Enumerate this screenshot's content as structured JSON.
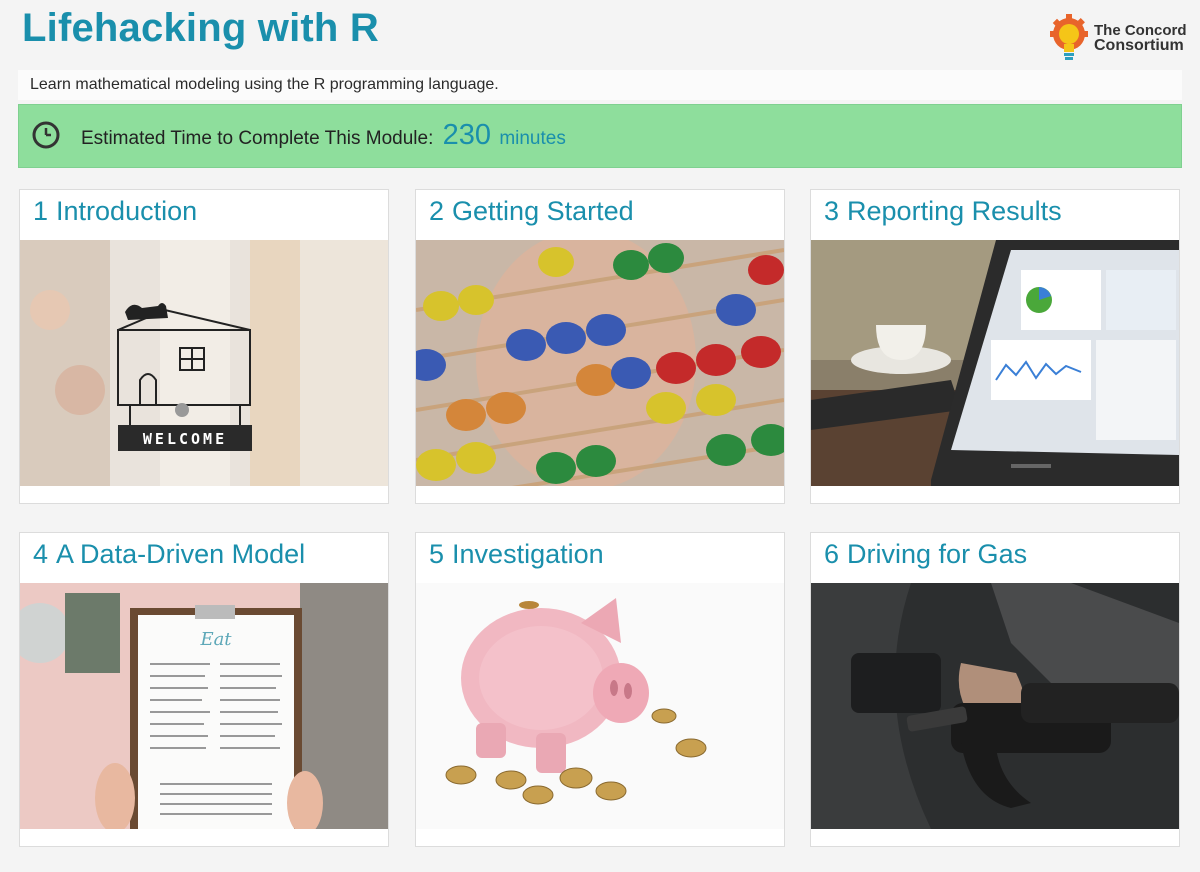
{
  "header": {
    "title": "Lifehacking with R",
    "logo": {
      "line1": "The Concord",
      "line2": "Consortium",
      "icon": "lightbulb-gear-icon"
    }
  },
  "subtitle": "Learn mathematical modeling using the R programming language.",
  "banner": {
    "label": "Estimated Time to Complete This Module:",
    "value": "230",
    "unit": "minutes",
    "icon": "clock-icon",
    "color": "#8ede9c"
  },
  "accent_color": "#1a8fac",
  "modules": [
    {
      "number": "1",
      "title": "Introduction",
      "image": "welcome-sign-image",
      "sign_text": "WELCOME"
    },
    {
      "number": "2",
      "title": "Getting Started",
      "image": "abacus-image"
    },
    {
      "number": "3",
      "title": "Reporting Results",
      "image": "tablet-dashboard-image"
    },
    {
      "number": "4",
      "title": "A Data-Driven Model",
      "image": "menu-image",
      "menu_heading": "Eat"
    },
    {
      "number": "5",
      "title": "Investigation",
      "image": "piggy-bank-image"
    },
    {
      "number": "6",
      "title": "Driving for Gas",
      "image": "gas-pump-image"
    }
  ]
}
